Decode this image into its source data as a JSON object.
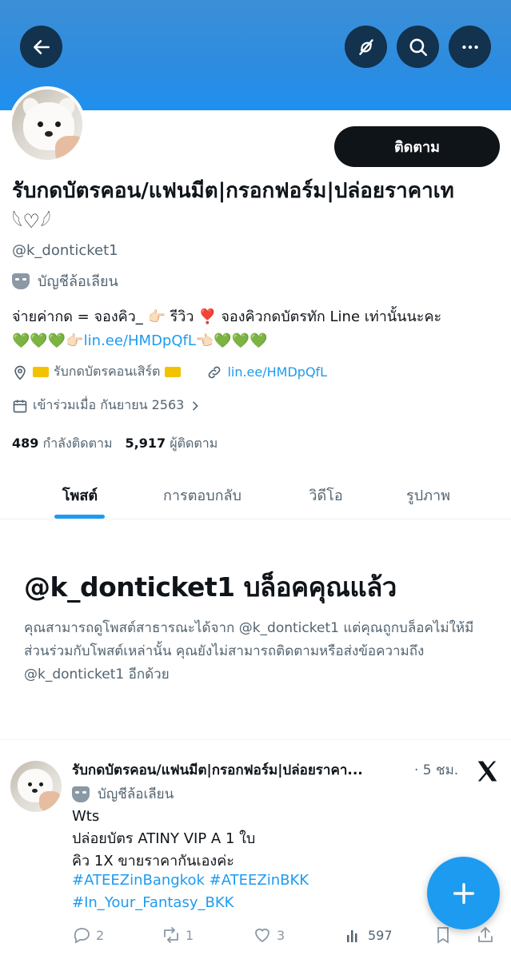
{
  "header": {
    "back_icon": "arrow-left-icon",
    "translate_icon": "translate-off-icon",
    "search_icon": "search-icon",
    "more_icon": "more-horizontal-icon",
    "banner_color": "#2d8ce0"
  },
  "profile": {
    "follow_label": "ติดตาม",
    "display_name": "รับกดบัตรคอน/แฟนมีต|กรอกฟอร์ม|ปล่อยราคาเท",
    "display_name_emoji": "𓆩♡𓆪",
    "handle": "@k_donticket1",
    "parody_label": "บัญชีล้อเลียน",
    "bio_line1": "จ่ายค่ากด = จองคิว_ 👉🏻 รีวิว ❣️ จองคิวกดบัตรทัก Line เท่านั้นนะคะ",
    "bio_line2_prefix": "💚💚💚👉🏻",
    "bio_link": "lin.ee/HMDpQfL",
    "bio_line2_suffix": "👈🏻💚💚💚",
    "location": "รับกดบัตรคอนเสิร์ต",
    "website": "lin.ee/HMDpQfL",
    "joined": "เข้าร่วมเมื่อ กันยายน 2563",
    "following_count": "489",
    "following_label": "กำลังติดตาม",
    "followers_count": "5,917",
    "followers_label": "ผู้ติดตาม"
  },
  "tabs": [
    {
      "label": "โพสต์"
    },
    {
      "label": "การตอบกลับ"
    },
    {
      "label": "วิดีโอ"
    },
    {
      "label": "รูปภาพ"
    }
  ],
  "blocked": {
    "title_handle": "@k_donticket1",
    "title_suffix": "บล็อคคุณแล้ว",
    "text": "คุณสามารถดูโพสต์สาธารณะได้จาก @k_donticket1 แต่คุณถูกบล็อคไม่ให้มีส่วนร่วมกับโพสต์เหล่านั้น คุณยังไม่สามารถติดตามหรือส่งข้อความถึง @k_donticket1 อีกด้วย"
  },
  "post": {
    "author_name": "รับกดบัตรคอน/แฟนมีต|กรอกฟอร์ม|ปล่อยราคา...",
    "time": "· 5 ชม.",
    "parody_label": "บัญชีล้อเลียน",
    "body": "Wts\nปล่อยบัตร ATINY VIP A  1 ใบ\nคิว 1X ขายราคากันเองค่ะ",
    "tags_line1": "#ATEEZinBangkok #ATEEZinBKK",
    "tags_line2": "#In_Your_Fantasy_BKK",
    "replies": "2",
    "reposts": "1",
    "likes": "3",
    "views": "597"
  },
  "fab_icon": "plus-icon",
  "colors": {
    "accent": "#1d9bf0",
    "text": "#0f1419",
    "muted": "#536471"
  }
}
